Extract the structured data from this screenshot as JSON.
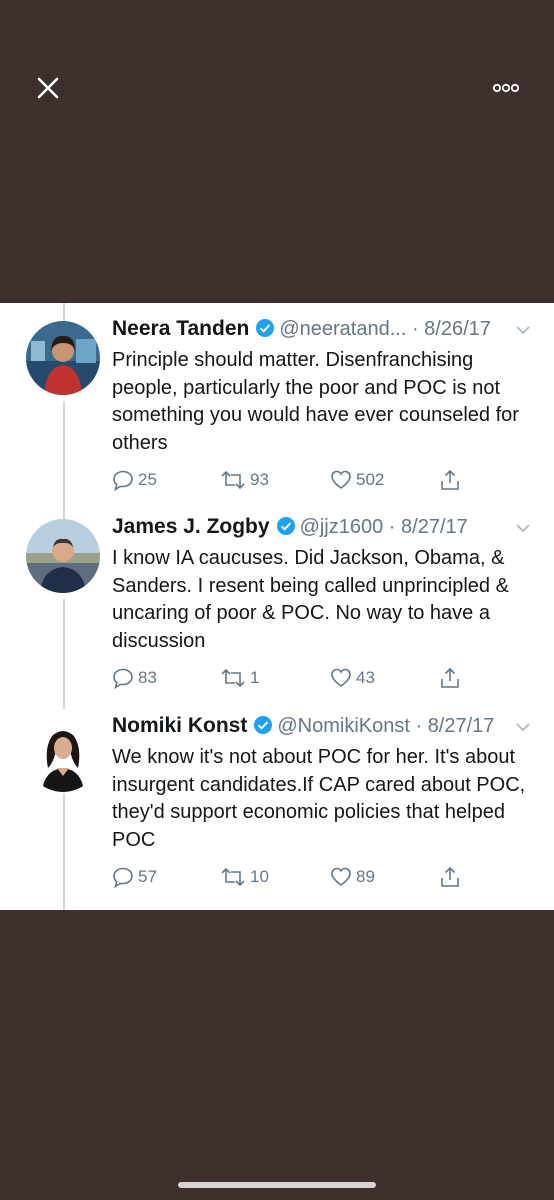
{
  "tweets": [
    {
      "name": "Neera Tanden",
      "handle": "@neeratand...",
      "date": "8/26/17",
      "text": "Principle should matter.  Disenfranchising people, particularly the poor and POC is not something you would have ever counseled for others",
      "replies": "25",
      "retweets": "93",
      "likes": "502"
    },
    {
      "name": "James J. Zogby",
      "handle": "@jjz1600",
      "date": "8/27/17",
      "text": "I know IA caucuses. Did Jackson, Obama, & Sanders. I resent being called unprincipled & uncaring of poor & POC. No way to have a discussion",
      "replies": "83",
      "retweets": "1",
      "likes": "43"
    },
    {
      "name": "Nomiki Konst",
      "handle": "@NomikiKonst",
      "date": "8/27/17",
      "text": "We know it's not about POC for her. It's about insurgent candidates.If CAP cared about POC, they'd support economic policies that helped POC",
      "replies": "57",
      "retweets": "10",
      "likes": "89"
    }
  ],
  "colors": {
    "background": "#3d302d",
    "panel": "#ffffff",
    "verified": "#1da1f2",
    "meta": "#657786"
  },
  "icons": [
    "close-icon",
    "more-icon",
    "verified-icon",
    "chevron-down-icon",
    "reply-icon",
    "retweet-icon",
    "like-icon",
    "share-icon"
  ]
}
